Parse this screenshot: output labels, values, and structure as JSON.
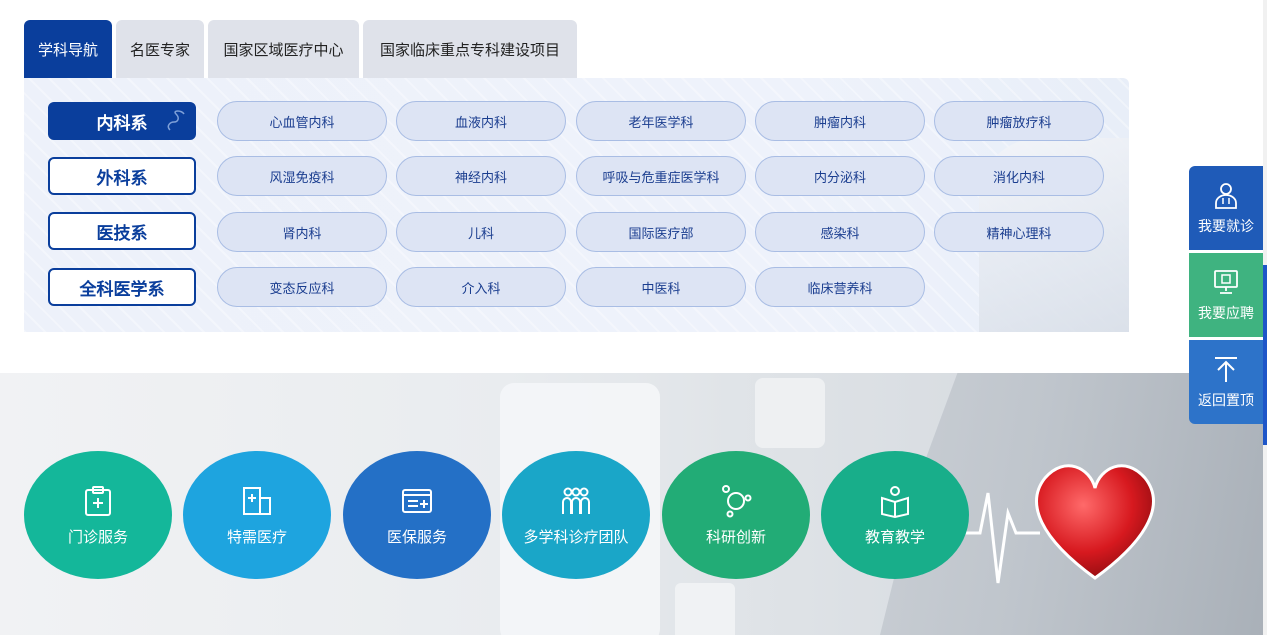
{
  "tabs": [
    "学科导航",
    "名医专家",
    "国家区域医疗中心",
    "国家临床重点专科建设项目"
  ],
  "categories": [
    "内科系",
    "外科系",
    "医技系",
    "全科医学系"
  ],
  "departments": [
    [
      "心血管内科",
      "血液内科",
      "老年医学科",
      "肿瘤内科",
      "肿瘤放疗科"
    ],
    [
      "风湿免疫科",
      "神经内科",
      "呼吸与危重症医学科",
      "内分泌科",
      "消化内科"
    ],
    [
      "肾内科",
      "儿科",
      "国际医疗部",
      "感染科",
      "精神心理科"
    ],
    [
      "变态反应科",
      "介入科",
      "中医科",
      "临床营养科"
    ]
  ],
  "services": [
    {
      "label": "门诊服务",
      "icon": "clipboard-plus-icon",
      "color": "#14b79a"
    },
    {
      "label": "特需医疗",
      "icon": "hospital-building-icon",
      "color": "#1ea4df"
    },
    {
      "label": "医保服务",
      "icon": "insurance-card-icon",
      "color": "#2470c6"
    },
    {
      "label": "多学科诊疗团队",
      "icon": "team-icon",
      "color": "#1aa6c8"
    },
    {
      "label": "科研创新",
      "icon": "molecule-icon",
      "color": "#22ac76"
    },
    {
      "label": "教育教学",
      "icon": "book-reader-icon",
      "color": "#18ae8a"
    }
  ],
  "side": [
    {
      "label": "我要就诊",
      "icon": "doctor-icon",
      "color": "#1f5bb8"
    },
    {
      "label": "我要应聘",
      "icon": "monitor-icon",
      "color": "#3fb380"
    },
    {
      "label": "返回置顶",
      "icon": "arrow-up-icon",
      "color": "#2d73c9"
    }
  ]
}
